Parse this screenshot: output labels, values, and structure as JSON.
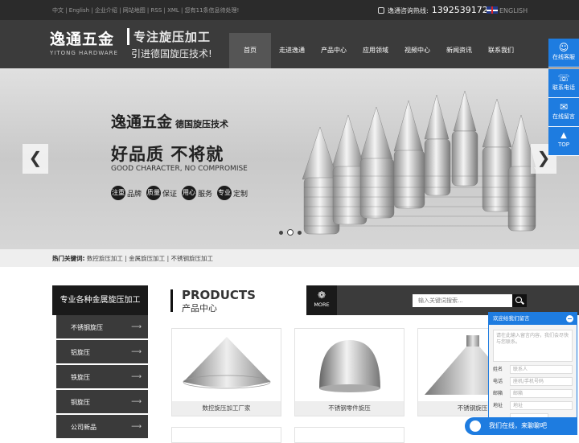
{
  "topbar": {
    "links": "中文 | English | 企业介绍 | 网站地图 | RSS | XML | 您有11条信息待处理!",
    "hotline_label": "逸通咨询热线:",
    "hotline_number": "13925391729",
    "lang": "ENGLISH"
  },
  "logo": {
    "cn": "逸通五金",
    "en": "YITONG HARDWARE"
  },
  "slogan": {
    "line1": "专注旋压加工",
    "line2": "引进德国旋压技术!"
  },
  "nav": [
    "首页",
    "走进逸通",
    "产品中心",
    "应用领域",
    "视频中心",
    "新闻资讯",
    "联系我们"
  ],
  "banner": {
    "title": "逸通五金",
    "title_sub": "德国旋压技术",
    "headline": "好品质  不将就",
    "headline_en": "GOOD CHARACTER, NO COMPROMISE",
    "tags": [
      {
        "badge": "注重",
        "text": "品牌"
      },
      {
        "badge": "质量",
        "text": "保证"
      },
      {
        "badge": "用心",
        "text": "服务"
      },
      {
        "badge": "专业",
        "text": "定制"
      }
    ],
    "prev": "❮",
    "next": "❯"
  },
  "hot_keywords": {
    "label": "热门关键词:",
    "items": "数控旋压加工 | 金属旋压加工 | 不锈钢旋压加工"
  },
  "sidebar": {
    "title": "专业各种金属旋压加工",
    "items": [
      "不锈钢旋压",
      "铝旋压",
      "铁旋压",
      "铜旋压",
      "公司新品"
    ],
    "arrow": "⟶"
  },
  "products": {
    "title_en": "PRODUCTS",
    "title_cn": "产品中心",
    "more": "MORE",
    "search_placeholder": "输入关键词搜索...",
    "items": [
      "数控旋压加工厂家",
      "不锈钢零件旋压",
      "不锈钢旋压"
    ]
  },
  "float_bar": [
    {
      "icon": "☺",
      "label": "在线客服"
    },
    {
      "icon": "☏",
      "label": "联系电话"
    },
    {
      "icon": "✉",
      "label": "在线留言"
    },
    {
      "icon": "▲",
      "label": "TOP"
    }
  ],
  "chat": {
    "title": "欢迎给我们留言",
    "textarea_placeholder": "请在此输入留言内容，我们会尽快与您联系。",
    "fields": [
      {
        "label": "姓名",
        "placeholder": "联系人"
      },
      {
        "label": "电话",
        "placeholder": "座机/手机号码"
      },
      {
        "label": "邮箱",
        "placeholder": "邮箱"
      },
      {
        "label": "地址",
        "placeholder": "地址"
      }
    ],
    "bottom": "我们在线，来聊聊吧"
  },
  "colors": {
    "accent": "#1e7ce0",
    "dark": "#3b3b3b"
  }
}
